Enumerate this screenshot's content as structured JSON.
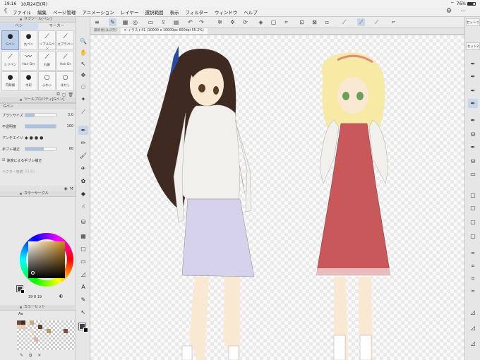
{
  "status": {
    "time": "19:16",
    "date": "10月24日(月)",
    "battery": "76%"
  },
  "menu": [
    "ファイル",
    "編集",
    "ページ管理",
    "アニメーション",
    "レイヤー",
    "選択範囲",
    "表示",
    "フィルター",
    "ウィンドウ",
    "ヘルプ"
  ],
  "tabs": [
    "最新絵(ほぼ完)",
    "イラスト41 (10000 x 10000px 600dpi 55.2%)"
  ],
  "subtool": {
    "title": "サブツール[ペン]",
    "tabs": [
      "ペン",
      "マーカー"
    ],
    "brushes": [
      "Gペン",
      "丸ペン",
      "リアルGペン",
      "カブラペン",
      "ミリペン",
      "Hair Drs",
      "丸筆",
      "Hair Dr",
      "内跡線",
      "水彩",
      "ふわっ",
      "ほかし"
    ]
  },
  "toolprop": {
    "title": "ツールプロパティ[Gペン]",
    "brush_name": "Gペン",
    "rows": [
      {
        "label": "ブラシサイズ",
        "value": "3.0",
        "fraction": 0.3
      },
      {
        "label": "不透明度",
        "value": "100",
        "fraction": 1.0
      },
      {
        "label": "アンチエイリ",
        "value": "",
        "fraction": 0.0
      },
      {
        "label": "手ブレ補正",
        "value": "60",
        "fraction": 0.6
      }
    ],
    "speed_label": "速度による手ブレ補正",
    "vector_label": "ベクター吸着"
  },
  "colorwheel": {
    "title": "カラーサークル",
    "readout": "39  8  19"
  },
  "colorset": {
    "title": "カラーセット",
    "dropdown": "Aa"
  },
  "right_panel": {
    "tab1": "セットゥ",
    "tab2": "セット2"
  },
  "colors": {
    "accent": "#c9d6ea",
    "selected": "#b39869"
  }
}
